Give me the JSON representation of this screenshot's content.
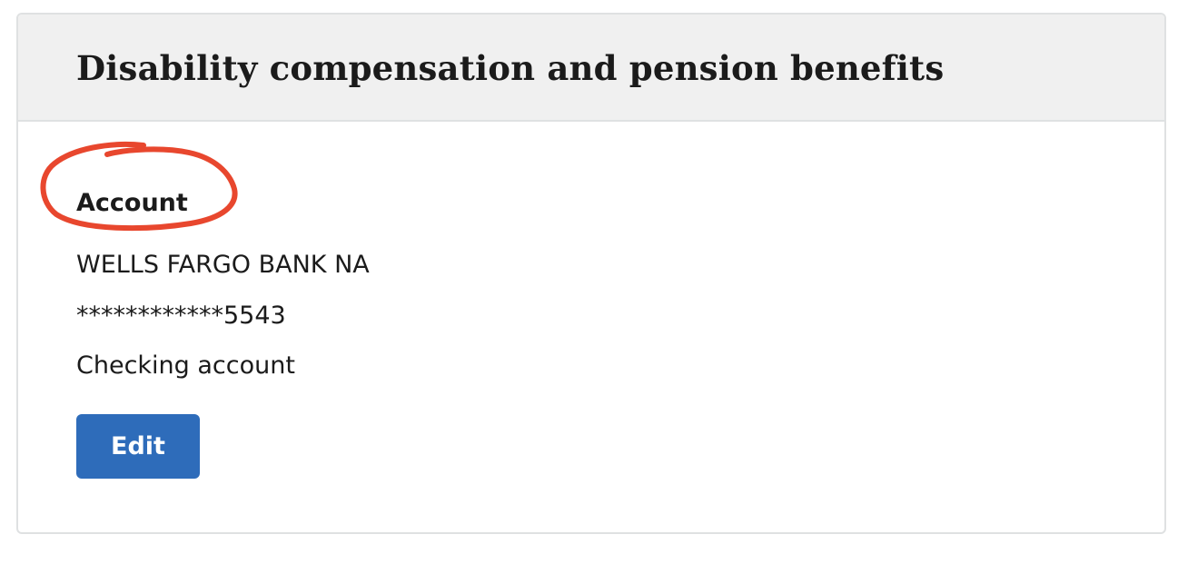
{
  "card": {
    "title": "Disability compensation and pension benefits"
  },
  "account": {
    "heading": "Account",
    "bank_name": "WELLS FARGO BANK NA",
    "account_number": "************5543",
    "account_type": "Checking account",
    "edit_label": "Edit"
  },
  "colors": {
    "header_background": "#f0f0f0",
    "button_background": "#2e6cba",
    "annotation_circle": "#e8472e"
  }
}
